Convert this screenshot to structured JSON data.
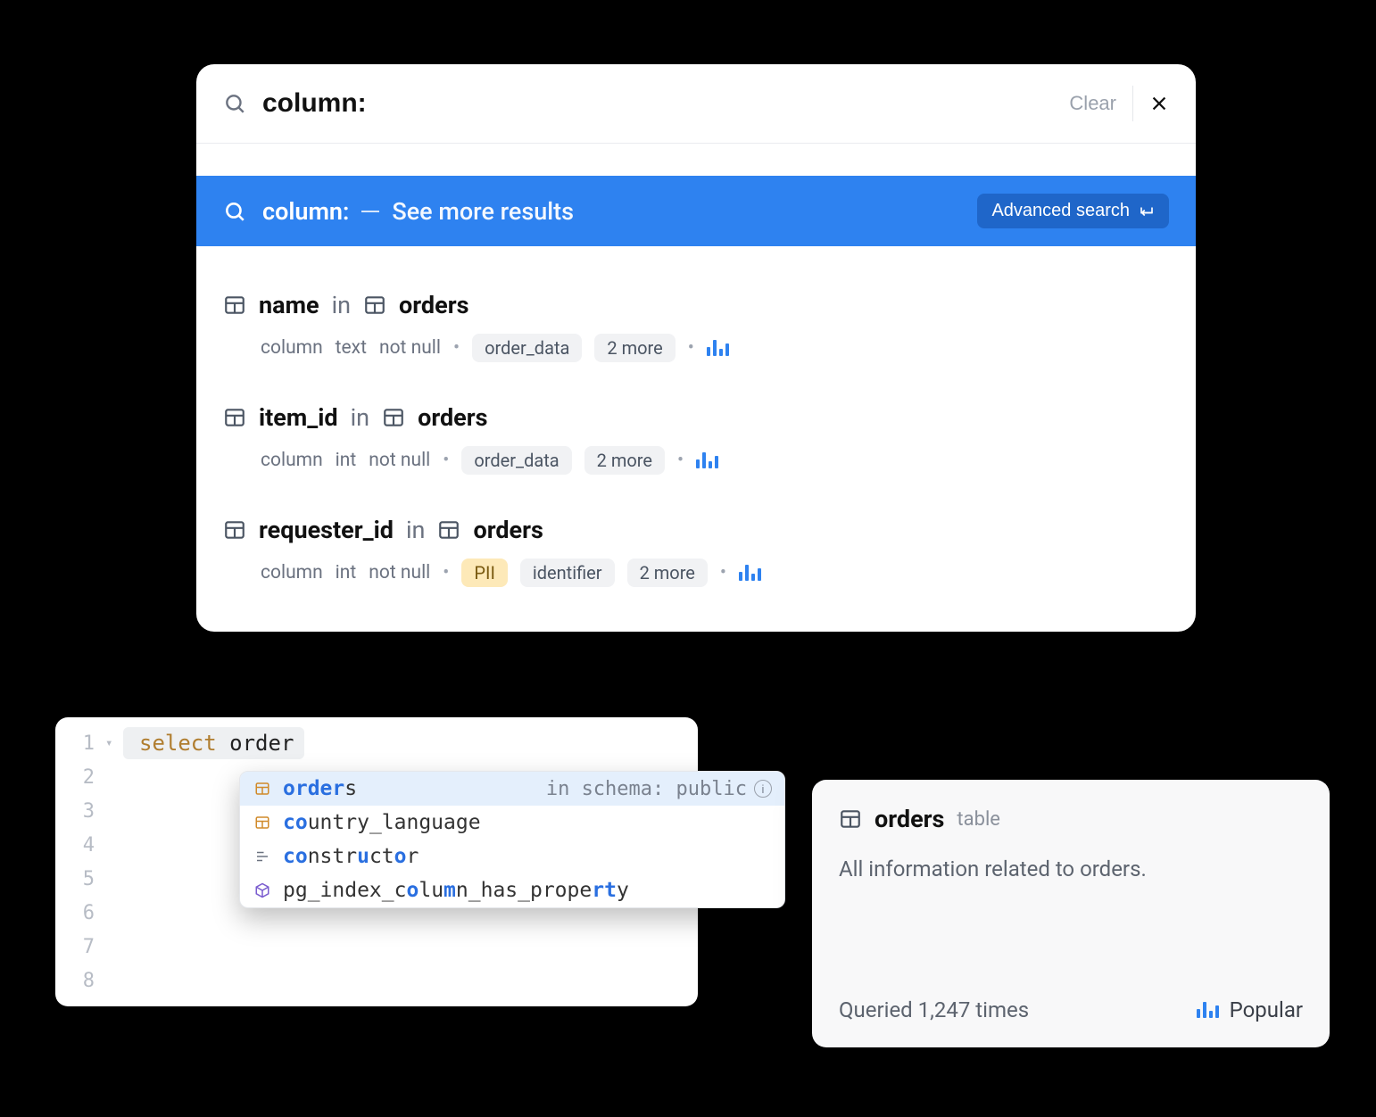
{
  "search": {
    "value": "column:",
    "clear_label": "Clear"
  },
  "highlight": {
    "prefix": "column:",
    "more": "See more results",
    "advanced_label": "Advanced search"
  },
  "results": [
    {
      "column": "name",
      "in": "in",
      "table": "orders",
      "kind": "column",
      "dtype": "text",
      "nullability": "not null",
      "tags": [
        "order_data"
      ],
      "more_count": "2 more",
      "pii": false
    },
    {
      "column": "item_id",
      "in": "in",
      "table": "orders",
      "kind": "column",
      "dtype": "int",
      "nullability": "not null",
      "tags": [
        "order_data"
      ],
      "more_count": "2 more",
      "pii": false
    },
    {
      "column": "requester_id",
      "in": "in",
      "table": "orders",
      "kind": "column",
      "dtype": "int",
      "nullability": "not null",
      "tags": [
        "identifier"
      ],
      "more_count": "2 more",
      "pii": true,
      "pii_label": "PII"
    }
  ],
  "editor": {
    "line_numbers": [
      "1",
      "2",
      "3",
      "4",
      "5",
      "6",
      "7",
      "8"
    ],
    "keyword": "select",
    "rest": " order"
  },
  "autocomplete": {
    "hint_prefix": "in schema: ",
    "hint_schema": "public",
    "items": [
      {
        "pre": "",
        "match": "order",
        "post": "s",
        "icon": "table",
        "selected": true
      },
      {
        "pre": "",
        "match": "co",
        "mid1": "untr",
        "match2": "",
        "post": "y_language",
        "icon": "table",
        "selected": false,
        "raw": "country_language"
      },
      {
        "pre": "",
        "match": "co",
        "mid1": "nstr",
        "match2": "u",
        "mid2": "ct",
        "match3": "o",
        "post": "r",
        "icon": "snippet",
        "selected": false,
        "raw": "constructor"
      },
      {
        "pre": "pg_index_c",
        "match": "o",
        "mid1": "lu",
        "match2": "m",
        "mid2": "n_has_prope",
        "match3": "rt",
        "post": "y",
        "icon": "cube",
        "selected": false,
        "raw": "pg_index_column_has_property"
      }
    ]
  },
  "detail": {
    "name": "orders",
    "type": "table",
    "description": "All information related to orders.",
    "queried": "Queried 1,247 times",
    "popular": "Popular"
  }
}
